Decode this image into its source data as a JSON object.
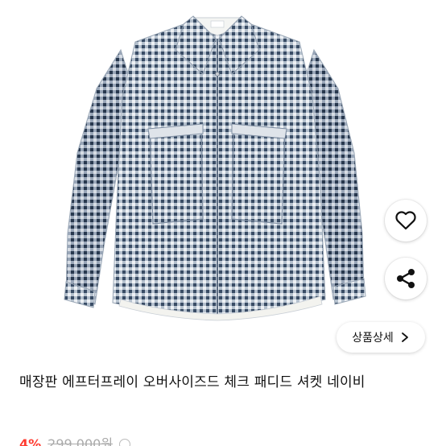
{
  "product": {
    "title": "매장판 에프터프레이 오버사이즈드 체크 패디드 셔켓 네이비",
    "image_alt_icon": "checked-shirt-jacket-image"
  },
  "actions": {
    "like_icon": "heart-outline-icon",
    "share_icon": "share-icon",
    "detail_label": "상품상세",
    "detail_icon": "chevron-right-icon"
  },
  "price": {
    "discount": "4%",
    "original": "299,000원"
  },
  "colors": {
    "discount": "#ff3b30",
    "fabric_dark": "#3a4d66",
    "fabric_light": "#e9edf2"
  }
}
